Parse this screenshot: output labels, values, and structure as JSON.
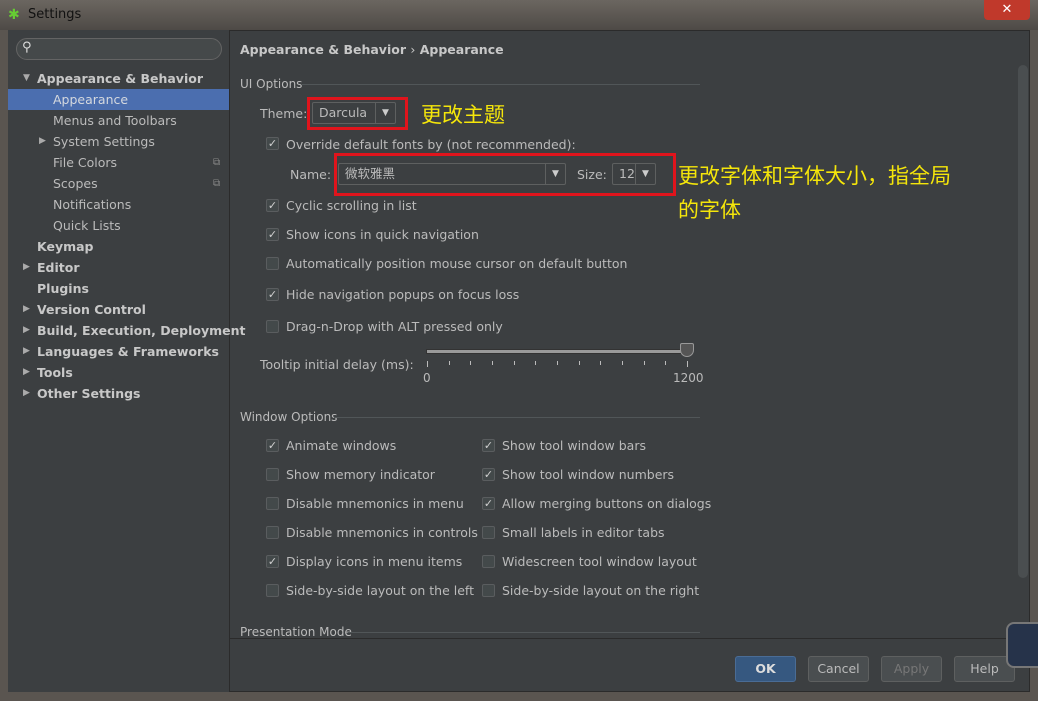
{
  "window": {
    "title": "Settings"
  },
  "sidebar": {
    "search_placeholder": "",
    "items": [
      {
        "label": "Appearance & Behavior",
        "level": 0,
        "expanded": true,
        "bold": true
      },
      {
        "label": "Appearance",
        "level": 1,
        "selected": true
      },
      {
        "label": "Menus and Toolbars",
        "level": 1
      },
      {
        "label": "System Settings",
        "level": 1,
        "expandable": true
      },
      {
        "label": "File Colors",
        "level": 1,
        "project_icon": true
      },
      {
        "label": "Scopes",
        "level": 1,
        "project_icon": true
      },
      {
        "label": "Notifications",
        "level": 1
      },
      {
        "label": "Quick Lists",
        "level": 1
      },
      {
        "label": "Keymap",
        "level": 0,
        "bold": true
      },
      {
        "label": "Editor",
        "level": 0,
        "bold": true,
        "expandable": true
      },
      {
        "label": "Plugins",
        "level": 0,
        "bold": true
      },
      {
        "label": "Version Control",
        "level": 0,
        "bold": true,
        "expandable": true
      },
      {
        "label": "Build, Execution, Deployment",
        "level": 0,
        "bold": true,
        "expandable": true
      },
      {
        "label": "Languages & Frameworks",
        "level": 0,
        "bold": true,
        "expandable": true
      },
      {
        "label": "Tools",
        "level": 0,
        "bold": true,
        "expandable": true
      },
      {
        "label": "Other Settings",
        "level": 0,
        "bold": true,
        "expandable": true
      }
    ]
  },
  "breadcrumb": {
    "parent": "Appearance & Behavior",
    "sep": "›",
    "current": "Appearance"
  },
  "ui_options": {
    "header": "UI Options",
    "theme_label": "Theme:",
    "theme_value": "Darcula",
    "override_label": "Override default fonts by (not recommended):",
    "override_checked": true,
    "name_label": "Name:",
    "font_name": "微软雅黑",
    "size_label": "Size:",
    "font_size": "12",
    "checkboxes": [
      {
        "label": "Cyclic scrolling in list",
        "checked": true
      },
      {
        "label": "Show icons in quick navigation",
        "checked": true
      },
      {
        "label": "Automatically position mouse cursor on default button",
        "checked": false
      },
      {
        "label": "Hide navigation popups on focus loss",
        "checked": true
      },
      {
        "label": "Drag-n-Drop with ALT pressed only",
        "checked": false
      }
    ],
    "tooltip_label": "Tooltip initial delay (ms):",
    "slider_min": "0",
    "slider_max": "1200",
    "slider_value": 1200
  },
  "window_options": {
    "header": "Window Options",
    "left": [
      {
        "label": "Animate windows",
        "checked": true
      },
      {
        "label": "Show memory indicator",
        "checked": false
      },
      {
        "label": "Disable mnemonics in menu",
        "checked": false
      },
      {
        "label": "Disable mnemonics in controls",
        "checked": false
      },
      {
        "label": "Display icons in menu items",
        "checked": true
      },
      {
        "label": "Side-by-side layout on the left",
        "checked": false
      }
    ],
    "right": [
      {
        "label": "Show tool window bars",
        "checked": true
      },
      {
        "label": "Show tool window numbers",
        "checked": true
      },
      {
        "label": "Allow merging buttons on dialogs",
        "checked": true
      },
      {
        "label": "Small labels in editor tabs",
        "checked": false
      },
      {
        "label": "Widescreen tool window layout",
        "checked": false
      },
      {
        "label": "Side-by-side layout on the right",
        "checked": false
      }
    ]
  },
  "presentation": {
    "header": "Presentation Mode"
  },
  "buttons": {
    "ok": "OK",
    "cancel": "Cancel",
    "apply": "Apply",
    "help": "Help"
  },
  "annotations": {
    "theme": "更改主题",
    "font_line1": "更改字体和字体大小，指全局",
    "font_line2": "的字体"
  },
  "colors": {
    "accent": "#4b6eaf",
    "annotation_box": "#e0141c",
    "annotation_text": "#f5e60a",
    "background": "#3c3f41"
  }
}
